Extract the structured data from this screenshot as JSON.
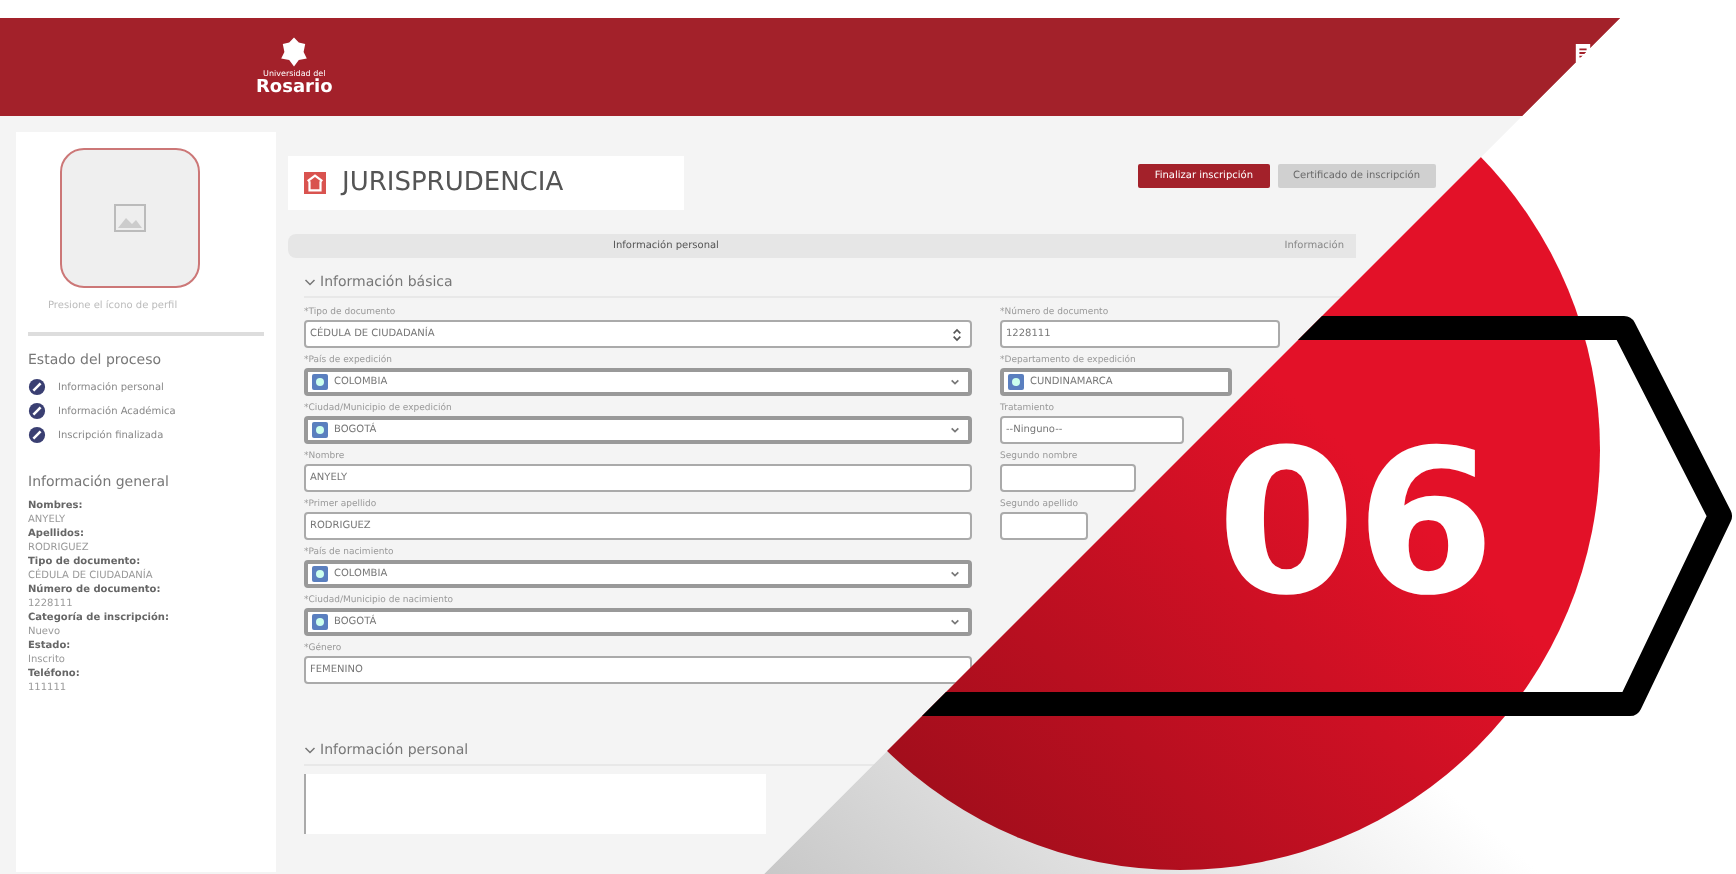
{
  "header": {
    "logo_small": "Universidad del",
    "logo_name": "Rosario"
  },
  "sidebar": {
    "photo_caption": "Presione el ícono de perfil",
    "process_title": "Estado del proceso",
    "steps": [
      {
        "label": "Información personal",
        "done": true
      },
      {
        "label": "Información Académica",
        "done": true
      },
      {
        "label": "Inscripción finalizada",
        "done": true
      }
    ],
    "general_title": "Información general",
    "general": [
      {
        "label": "Nombres:",
        "value": "ANYELY"
      },
      {
        "label": "Apellidos:",
        "value": "RODRIGUEZ"
      },
      {
        "label": "Tipo de documento:",
        "value": "CÉDULA DE CIUDADANÍA"
      },
      {
        "label": "Número de documento:",
        "value": "1228111"
      },
      {
        "label": "Categoría de inscripción:",
        "value": "Nuevo"
      },
      {
        "label": "Estado:",
        "value": "Inscrito"
      },
      {
        "label": "Teléfono:",
        "value": "111111"
      }
    ]
  },
  "title": "JURISPRUDENCIA",
  "buttons": [
    {
      "label": "Finalizar inscripción",
      "disabled": false
    },
    {
      "label": "Certificado de inscripción",
      "disabled": true
    }
  ],
  "tabs": [
    {
      "label": "Información personal",
      "selected": true
    },
    {
      "label": "Información",
      "selected": false
    }
  ],
  "section_basic": "Información básica",
  "left_fields": [
    {
      "label": "*Tipo de documento",
      "value": "CÉDULA DE CIUDADANÍA",
      "kind": "spinner"
    },
    {
      "label": "*País de expedición",
      "value": "COLOMBIA",
      "kind": "flag"
    },
    {
      "label": "*Ciudad/Municipio de expedición",
      "value": "BOGOTÁ",
      "kind": "flag"
    },
    {
      "label": "*Nombre",
      "value": "ANYELY",
      "kind": "text"
    },
    {
      "label": "*Primer apellido",
      "value": "RODRIGUEZ",
      "kind": "text"
    },
    {
      "label": "*País de nacimiento",
      "value": "COLOMBIA",
      "kind": "flag"
    },
    {
      "label": "*Ciudad/Municipio de nacimiento",
      "value": "BOGOTÁ",
      "kind": "flag"
    },
    {
      "label": "*Género",
      "value": "FEMENINO",
      "kind": "text"
    }
  ],
  "right_fields": [
    {
      "label": "*Número de documento",
      "value": "1228111",
      "kind": "text"
    },
    {
      "label": "*Departamento de expedición",
      "value": "CUNDINAMARCA",
      "kind": "flag"
    },
    {
      "label": "Tratamiento",
      "value": "--Ninguno--",
      "kind": "text"
    },
    {
      "label": "Segundo nombre",
      "kind": "text"
    },
    {
      "label": "Segundo apellido",
      "kind": "text"
    }
  ],
  "section_personal": "Información personal",
  "badge": "06"
}
